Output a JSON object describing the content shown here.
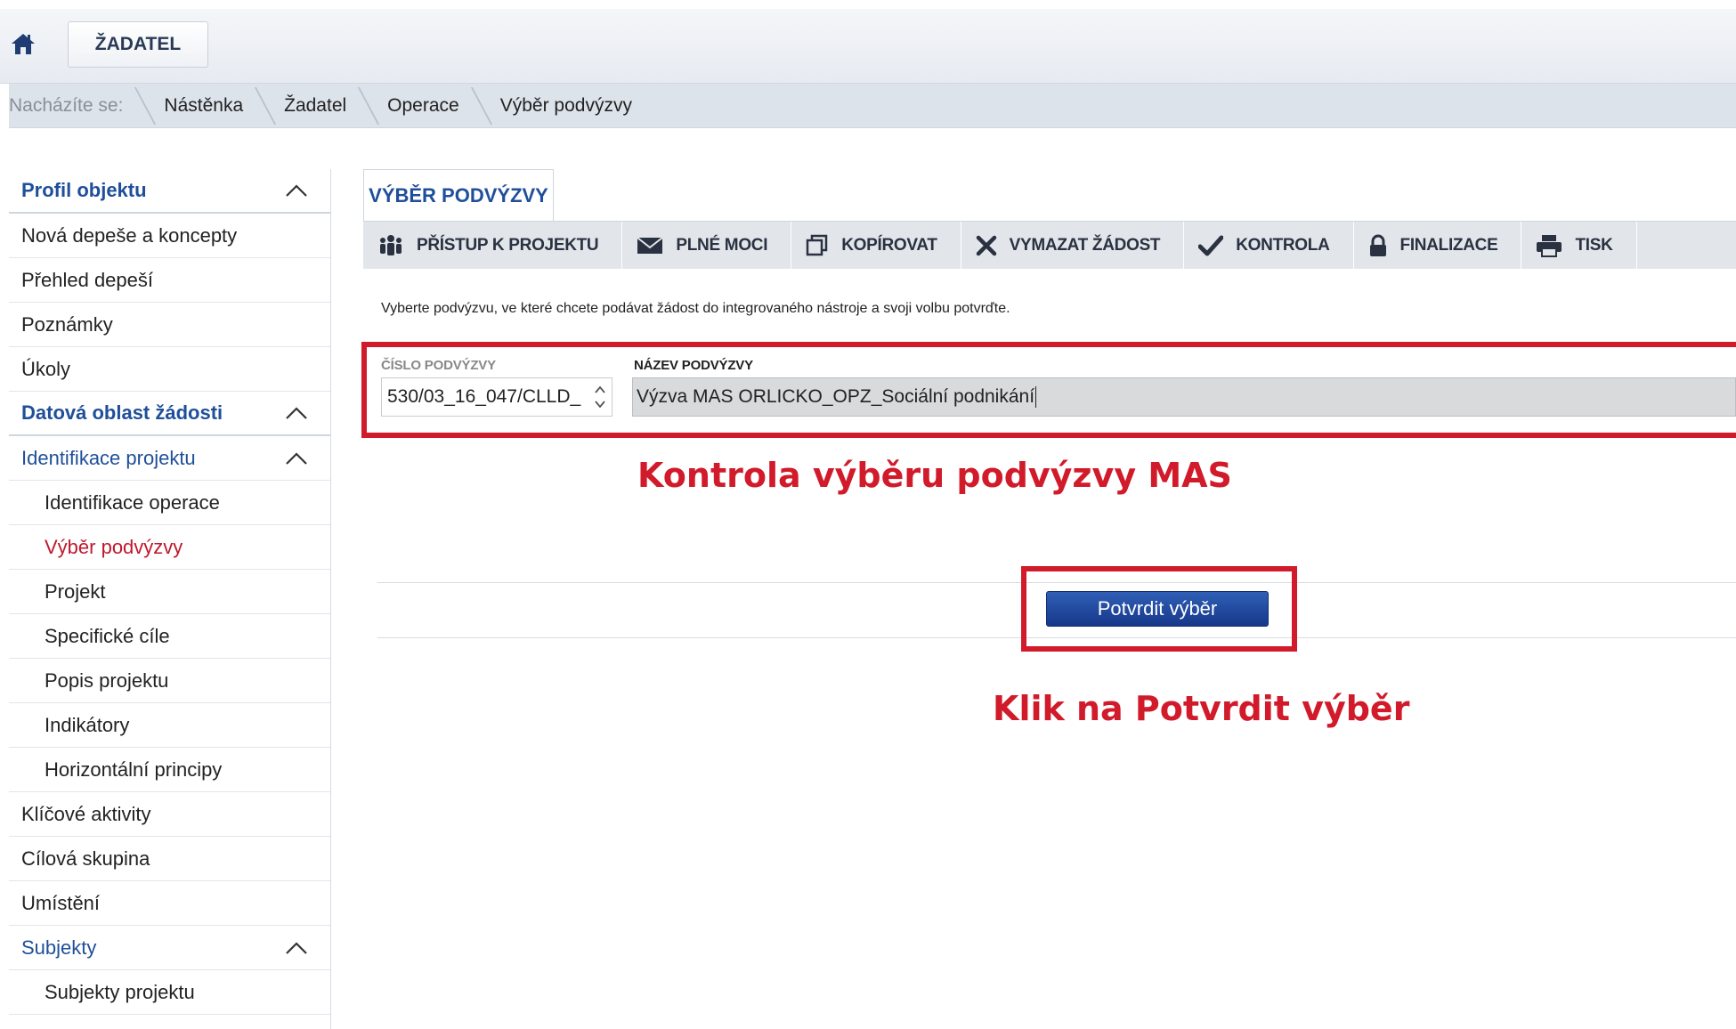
{
  "header": {
    "home_icon": "home-icon",
    "role_button": "ŽADATEL"
  },
  "breadcrumb": {
    "prefix": "Nacházíte se:",
    "items": [
      "Nástěnka",
      "Žadatel",
      "Operace",
      "Výběr podvýzvy"
    ]
  },
  "sidebar": {
    "items": [
      {
        "label": "Profil objektu"
      },
      {
        "label": "Nová depeše a koncepty"
      },
      {
        "label": "Přehled depeší"
      },
      {
        "label": "Poznámky"
      },
      {
        "label": "Úkoly"
      },
      {
        "label": "Datová oblast žádosti"
      },
      {
        "label": "Identifikace projektu"
      },
      {
        "label": "Identifikace operace"
      },
      {
        "label": "Výběr podvýzvy"
      },
      {
        "label": "Projekt"
      },
      {
        "label": "Specifické cíle"
      },
      {
        "label": "Popis projektu"
      },
      {
        "label": "Indikátory"
      },
      {
        "label": "Horizontální principy"
      },
      {
        "label": "Klíčové aktivity"
      },
      {
        "label": "Cílová skupina"
      },
      {
        "label": "Umístění"
      },
      {
        "label": "Subjekty"
      },
      {
        "label": "Subjekty projektu"
      }
    ]
  },
  "main": {
    "tab_label": "VÝBĚR PODVÝZVY",
    "toolbar": [
      {
        "label": "PŘÍSTUP K PROJEKTU",
        "icon": "people-icon"
      },
      {
        "label": "PLNÉ MOCI",
        "icon": "envelope-icon"
      },
      {
        "label": "KOPÍROVAT",
        "icon": "copy-icon"
      },
      {
        "label": "VYMAZAT ŽÁDOST",
        "icon": "delete-icon"
      },
      {
        "label": "KONTROLA",
        "icon": "check-icon"
      },
      {
        "label": "FINALIZACE",
        "icon": "lock-icon"
      },
      {
        "label": "TISK",
        "icon": "print-icon"
      }
    ],
    "hint": "Vyberte podvýzvu, ve které chcete podávat žádost do integrovaného nástroje a svoji volbu potvrďte.",
    "fields": {
      "number_label": "ČÍSLO PODVÝZVY",
      "number_value": "530/03_16_047/CLLD_",
      "name_label": "NÁZEV PODVÝZVY",
      "name_value": "Výzva MAS ORLICKO_OPZ_Sociální podnikání"
    },
    "confirm_button": "Potvrdit výběr"
  },
  "annotations": {
    "check_note": "Kontrola výběru podvýzvy MAS",
    "click_note": "Klik na Potvrdit výběr",
    "highlight_color": "#d11a2a"
  }
}
